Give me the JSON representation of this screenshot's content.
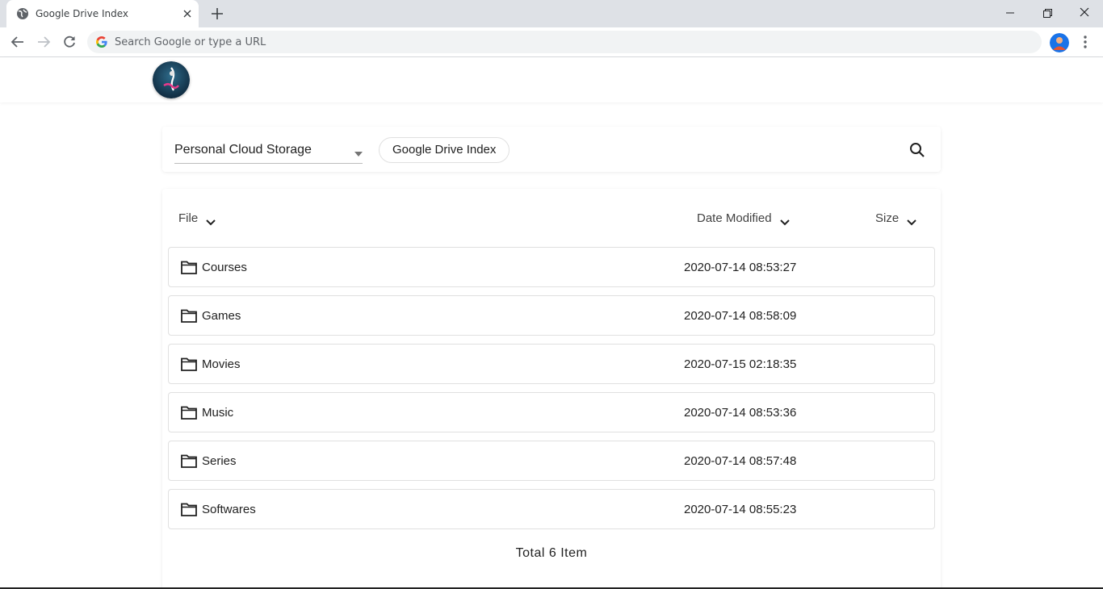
{
  "browser": {
    "tab_title": "Google Drive Index",
    "omnibox_placeholder": "Search Google or type a URL"
  },
  "header": {
    "drive_selected": "Personal Cloud Storage",
    "breadcrumb": "Google Drive Index"
  },
  "list": {
    "columns": {
      "file": "File",
      "date": "Date Modified",
      "size": "Size"
    },
    "rows": [
      {
        "name": "Courses",
        "date": "2020-07-14 08:53:27"
      },
      {
        "name": "Games",
        "date": "2020-07-14 08:58:09"
      },
      {
        "name": "Movies",
        "date": "2020-07-15 02:18:35"
      },
      {
        "name": "Music",
        "date": "2020-07-14 08:53:36"
      },
      {
        "name": "Series",
        "date": "2020-07-14 08:57:48"
      },
      {
        "name": "Softwares",
        "date": "2020-07-14 08:55:23"
      }
    ],
    "total": "Total 6 Item"
  },
  "colors": {
    "tabstrip": "#dee1e6",
    "omnibox": "#f1f3f4",
    "border": "#e0e0e0"
  }
}
